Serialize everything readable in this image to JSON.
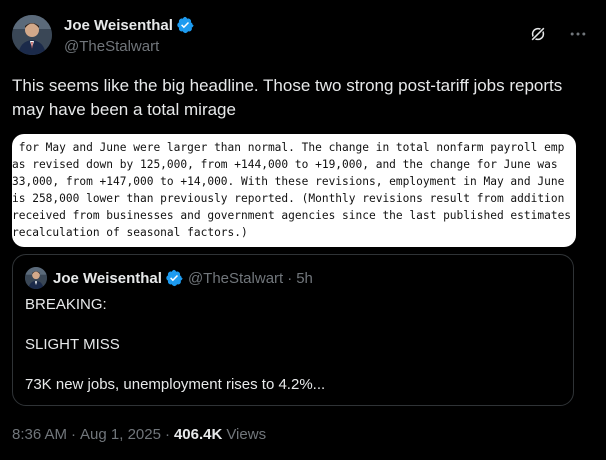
{
  "author": {
    "display_name": "Joe Weisenthal",
    "handle": "@TheStalwart",
    "avatar_icon": "person-avatar",
    "verified_icon": "verified-badge-icon",
    "verified_color": "#1d9bf0"
  },
  "actions": {
    "grok_icon": "grok-icon",
    "more_icon": "more-options-icon"
  },
  "tweet": {
    "text": "This seems like the big headline. Those two strong post-tariff jobs reports may have been a total mirage"
  },
  "media": {
    "lines": [
      " for May and June were larger than normal. The change in total nonfarm payroll emp",
      "as revised down by 125,000, from +144,000 to +19,000, and the change for June was",
      "33,000, from +147,000 to +14,000. With these revisions, employment in May and June",
      "is 258,000 lower than previously reported. (Monthly revisions result from addition",
      "received from businesses and government agencies since the last published estimates",
      "recalculation of seasonal factors.)"
    ]
  },
  "quote": {
    "display_name": "Joe Weisenthal",
    "handle": "@TheStalwart",
    "separator": "·",
    "time": "5h",
    "lines": [
      "BREAKING:",
      "",
      "SLIGHT MISS",
      "",
      "73K new jobs, unemployment rises to 4.2%..."
    ]
  },
  "meta": {
    "time": "8:36 AM",
    "separator": "·",
    "date": "Aug 1, 2025",
    "views_count": "406.4K",
    "views_label": "Views"
  }
}
